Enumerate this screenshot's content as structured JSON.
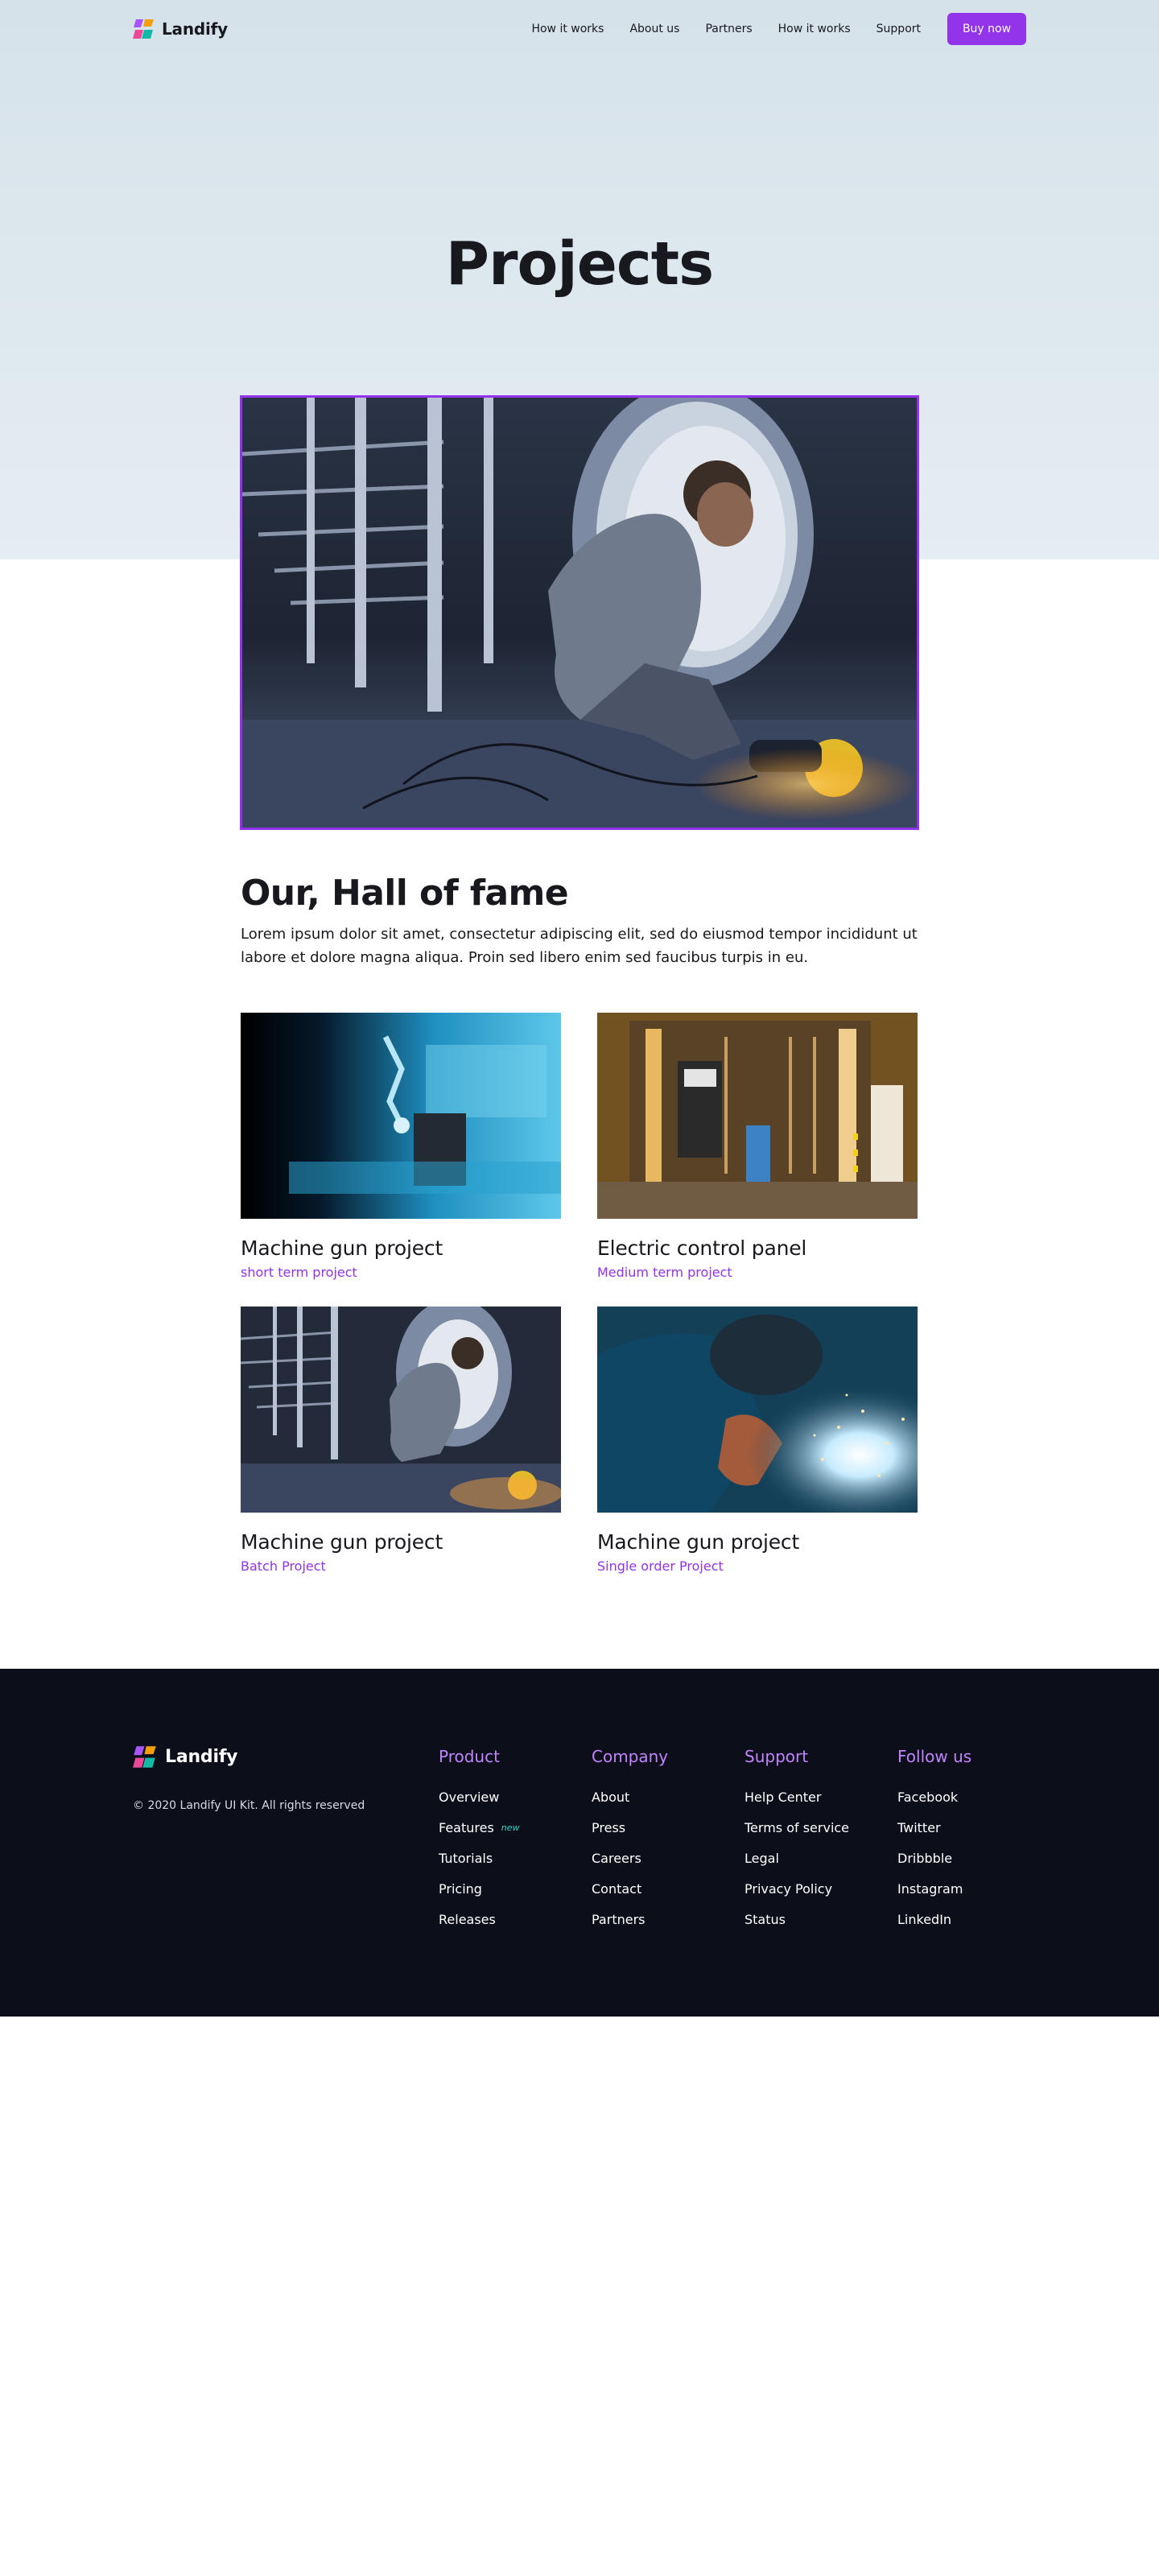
{
  "nav": {
    "brand": "Landify",
    "links": [
      "How it works",
      "About us",
      "Partners",
      "How it works",
      "Support"
    ],
    "cta": "Buy now"
  },
  "hero": {
    "title": "Projects"
  },
  "hall_of_fame": {
    "title": "Our, Hall of fame",
    "text": "Lorem ipsum dolor sit amet, consectetur adipiscing elit, sed do eiusmod tempor incididunt ut labore et dolore magna aliqua. Proin sed libero enim sed faucibus turpis in eu."
  },
  "projects": [
    {
      "title": "Machine gun project",
      "subtitle": "short term project"
    },
    {
      "title": "Electric control panel",
      "subtitle": "Medium term project"
    },
    {
      "title": "Machine gun project",
      "subtitle": "Batch Project"
    },
    {
      "title": "Machine gun project",
      "subtitle": "Single order Project"
    }
  ],
  "footer": {
    "brand": "Landify",
    "copyright": "© 2020 Landify UI Kit. All rights reserved",
    "columns": [
      {
        "title": "Product",
        "links": [
          "Overview",
          "Features",
          "Tutorials",
          "Pricing",
          "Releases"
        ],
        "badge": "new"
      },
      {
        "title": "Company",
        "links": [
          "About",
          "Press",
          "Careers",
          "Contact",
          "Partners"
        ]
      },
      {
        "title": "Support",
        "links": [
          "Help Center",
          "Terms of service",
          "Legal",
          "Privacy Policy",
          "Status"
        ]
      },
      {
        "title": "Follow us",
        "links": [
          "Facebook",
          "Twitter",
          "Dribbble",
          "Instagram",
          "LinkedIn"
        ]
      }
    ]
  },
  "colors": {
    "accent": "#9333ea",
    "footer_bg": "#0c0f1a",
    "footer_heading": "#c084fc",
    "badge": "#2dd4bf"
  }
}
